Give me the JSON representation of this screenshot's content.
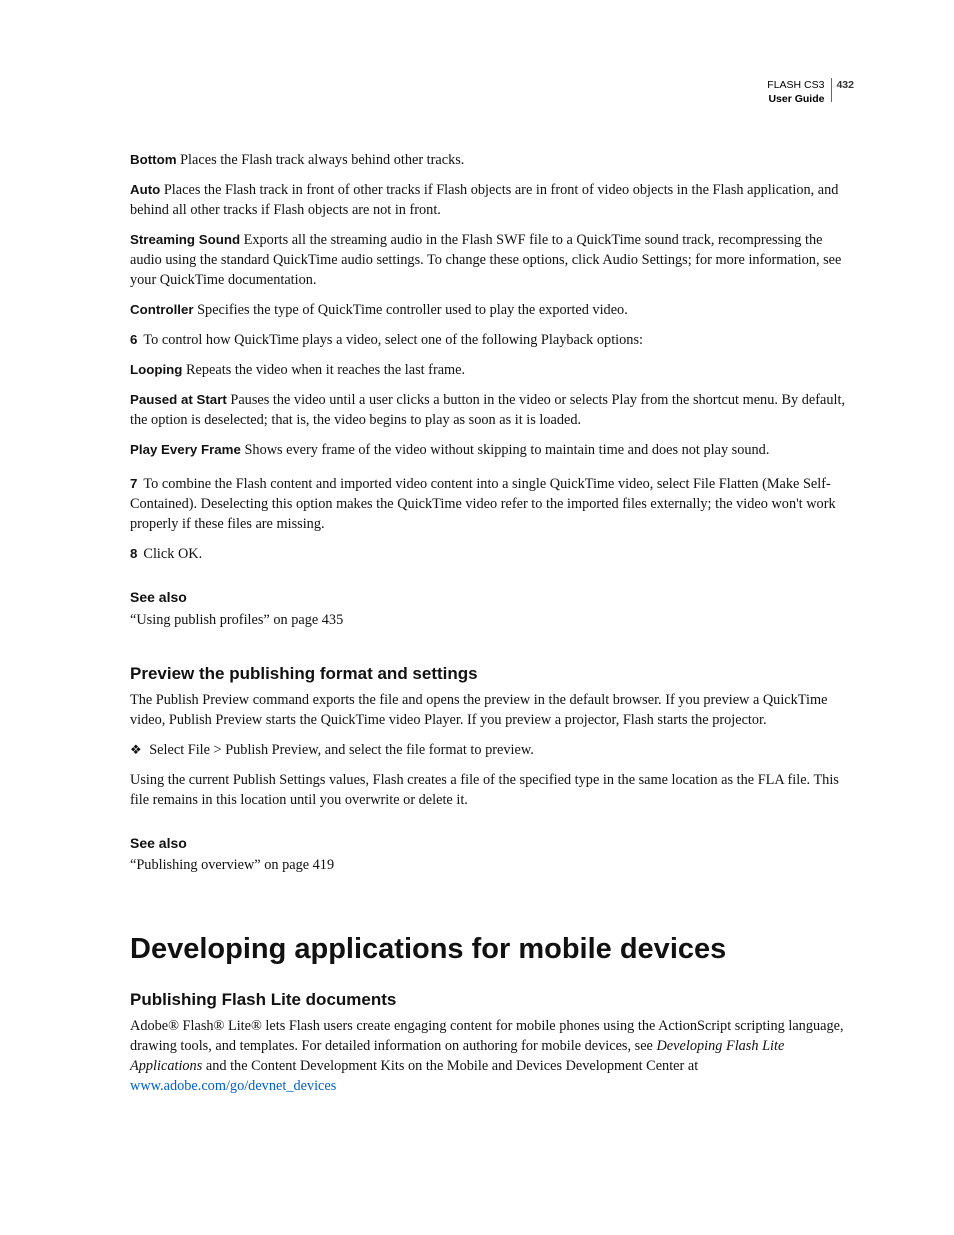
{
  "header": {
    "product": "FLASH CS3",
    "guide": "User Guide",
    "page_no": "432"
  },
  "defs": {
    "bottom_label": "Bottom",
    "bottom_text": "  Places the Flash track always behind other tracks.",
    "auto_label": "Auto",
    "auto_text": "  Places the Flash track in front of other tracks if Flash objects are in front of video objects in the Flash application, and behind all other tracks if Flash objects are not in front.",
    "streaming_label": "Streaming Sound",
    "streaming_text": "  Exports all the streaming audio in the Flash SWF file to a QuickTime sound track, recompressing the audio using the standard QuickTime audio settings. To change these options, click Audio Settings; for more information, see your QuickTime documentation.",
    "controller_label": "Controller",
    "controller_text": "  Specifies the type of QuickTime controller used to play the exported video.",
    "looping_label": "Looping",
    "looping_text": "  Repeats the video when it reaches the last frame.",
    "paused_label": "Paused at Start",
    "paused_text": "  Pauses the video until a user clicks a button in the video or selects Play from the shortcut menu. By default, the option is deselected; that is, the video begins to play as soon as it is loaded.",
    "playevery_label": "Play Every Frame",
    "playevery_text": "  Shows every frame of the video without skipping to maintain time and does not play sound."
  },
  "steps": {
    "s6_num": "6",
    "s6_text": "To control how QuickTime plays a video, select one of the following Playback options:",
    "s7_num": "7",
    "s7_text": "To combine the Flash content and imported video content into a single QuickTime video, select File Flatten (Make Self-Contained). Deselecting this option makes the QuickTime video refer to the imported files externally; the video won't work properly if these files are missing.",
    "s8_num": "8",
    "s8_text": "Click OK."
  },
  "seealso1": {
    "heading": "See also",
    "ref": "“Using publish profiles” on page 435"
  },
  "preview": {
    "heading": "Preview the publishing format and settings",
    "p1": "The Publish Preview command exports the file and opens the preview in the default browser. If you preview a QuickTime video, Publish Preview starts the QuickTime video Player. If you preview a projector, Flash starts the projector.",
    "bullet_sym": "❖",
    "bullet": "Select File > Publish Preview, and select the file format to preview.",
    "p2": "Using the current Publish Settings values, Flash creates a file of the specified type in the same location as the FLA file. This file remains in this location until you overwrite or delete it."
  },
  "seealso2": {
    "heading": "See also",
    "ref": "“Publishing overview” on page 419"
  },
  "chapter": {
    "title": "Developing applications for mobile devices"
  },
  "flashlite": {
    "heading": "Publishing Flash Lite documents",
    "p1_a": "Adobe® Flash® Lite® lets Flash users create engaging content for mobile phones using the ActionScript scripting language, drawing tools, and templates. For detailed information on authoring for mobile devices, see ",
    "p1_italic": "Developing Flash Lite Applications",
    "p1_b": " and the Content Development Kits on the Mobile and Devices Development Center at ",
    "link": "www.adobe.com/go/devnet_devices"
  }
}
